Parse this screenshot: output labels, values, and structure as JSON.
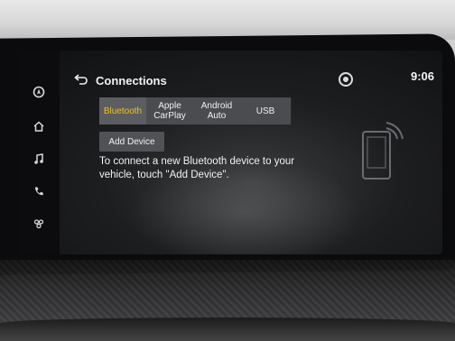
{
  "screen": {
    "title": "Connections",
    "time": "9:06"
  },
  "side_nav": {
    "items": [
      {
        "icon": "navigation-icon"
      },
      {
        "icon": "home-icon"
      },
      {
        "icon": "music-icon"
      },
      {
        "icon": "phone-icon"
      },
      {
        "icon": "apps-icon"
      }
    ]
  },
  "tabs": [
    {
      "label": "Bluetooth",
      "active": true
    },
    {
      "label": "Apple\nCarPlay",
      "active": false
    },
    {
      "label": "Android\nAuto",
      "active": false
    },
    {
      "label": "USB",
      "active": false
    }
  ],
  "add_device": {
    "label": "Add Device"
  },
  "instructions": "To connect a new Bluetooth device to your vehicle, touch \"Add Device\".",
  "colors": {
    "active_tab_text": "#f0c419",
    "tab_bg": "#4a4c50",
    "screen_bg": "#1d1e20"
  }
}
